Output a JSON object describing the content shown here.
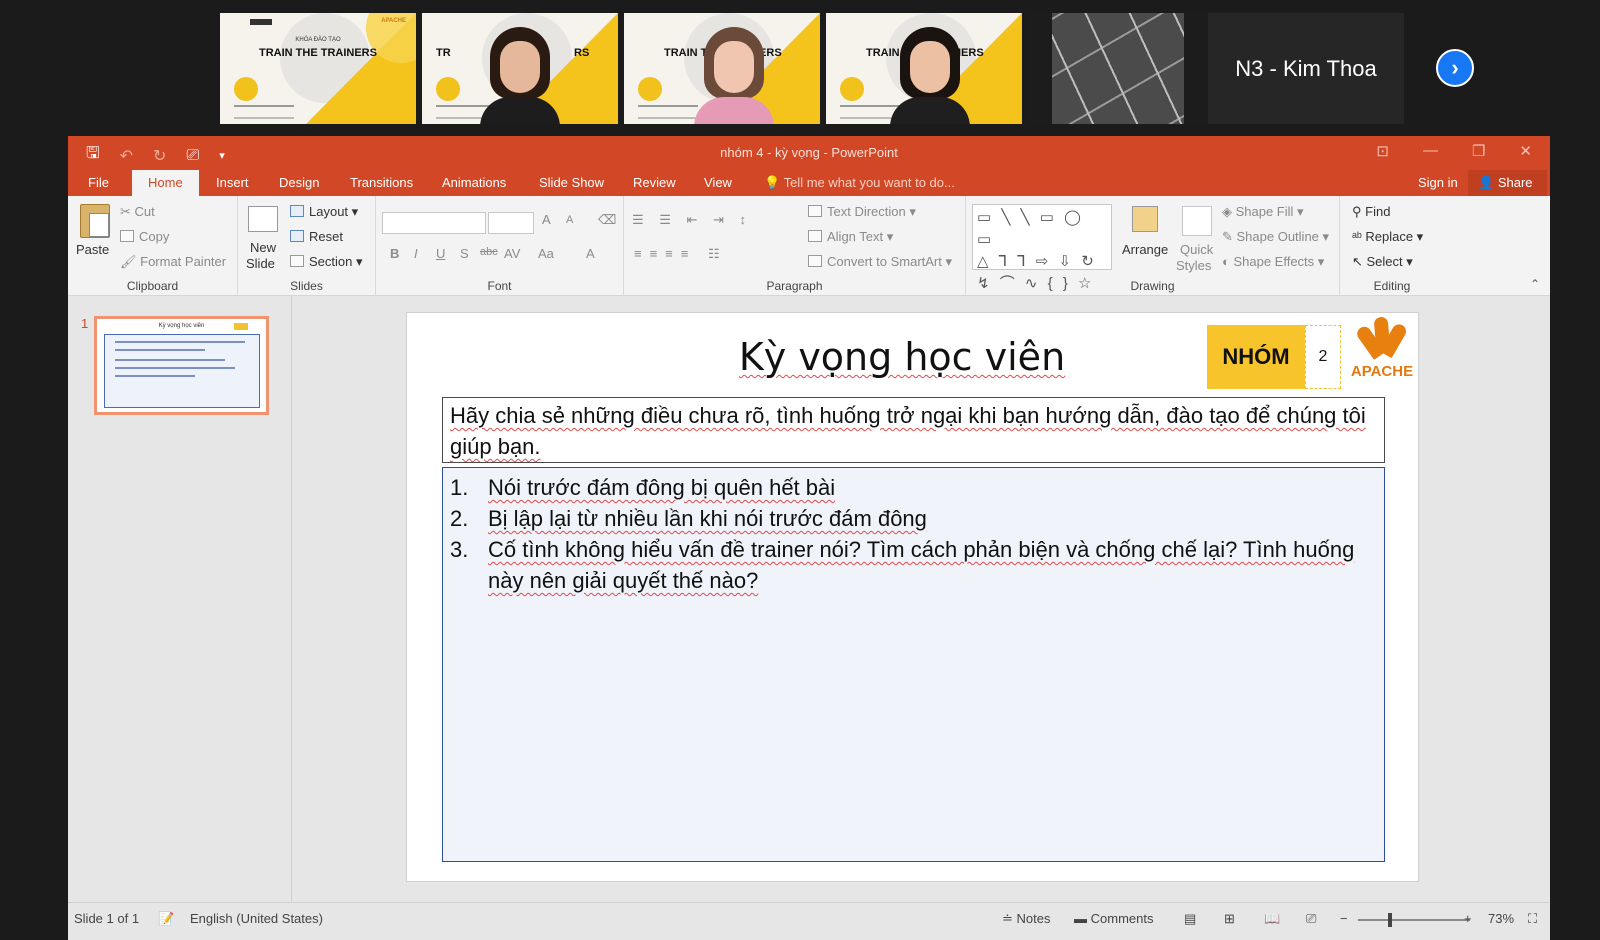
{
  "meeting": {
    "name_tile": "N3 - Kim Thoa",
    "slide_tile_sub": "KHÓA ĐÀO TẠO",
    "slide_tile_title": "TRAIN THE TRAINERS",
    "slide_tile_title_partial_1": "TR",
    "slide_tile_title_partial_1b": "RS",
    "slide_tile_title_partial_2": "TRAIN THE",
    "slide_tile_title_partial_2b": "IERS",
    "slide_tile_title_partial_3": "TRAIN",
    "slide_tile_title_partial_3b": "IERS",
    "tile_logo": "APACHE",
    "next_label": "›"
  },
  "window": {
    "title": "nhóm 4 - kỳ vọng - PowerPoint",
    "qat": {
      "save": "🖫",
      "undo": "↶",
      "redo": "↻",
      "present": "⎚",
      "more": "▾"
    },
    "controls": {
      "ribbon_display": "⊡",
      "minimize": "—",
      "restore": "❐",
      "close": "✕"
    }
  },
  "tabs": [
    "File",
    "Home",
    "Insert",
    "Design",
    "Transitions",
    "Animations",
    "Slide Show",
    "Review",
    "View"
  ],
  "active_tab": "Home",
  "tell_me": "Tell me what you want to do...",
  "sign_in": "Sign in",
  "share": "Share",
  "ribbon": {
    "clipboard": {
      "label": "Clipboard",
      "paste": "Paste",
      "cut": "Cut",
      "copy": "Copy",
      "format_painter": "Format Painter"
    },
    "slides": {
      "label": "Slides",
      "new_slide": "New",
      "new_slide_2": "Slide",
      "layout": "Layout",
      "reset": "Reset",
      "section": "Section"
    },
    "font": {
      "label": "Font",
      "font_name": "",
      "font_size": "",
      "grow": "A",
      "shrink": "A",
      "bold": "B",
      "italic": "I",
      "underline": "U",
      "strike": "S",
      "strike2": "abc",
      "spacing": "AV",
      "case": "Aa",
      "color": "A"
    },
    "paragraph": {
      "label": "Paragraph",
      "text_direction": "Text Direction",
      "align_text": "Align Text",
      "convert_smartart": "Convert to SmartArt"
    },
    "drawing": {
      "label": "Drawing",
      "arrange": "Arrange",
      "quick_styles": "Quick",
      "quick_styles_2": "Styles",
      "shape_fill": "Shape Fill",
      "shape_outline": "Shape Outline",
      "shape_effects": "Shape Effects",
      "shapes_row1": "▭ ╲ ╲ ▭ ◯ ▭",
      "shapes_row2": "△ ⅂ ⅂ ⇨ ⇩ ↻",
      "shapes_row3": "↯ ⌒ ∿ { } ☆"
    },
    "editing": {
      "label": "Editing",
      "find": "Find",
      "replace": "Replace",
      "select": "Select"
    }
  },
  "thumbnail": {
    "number": "1",
    "title": "Kỳ vọng học viên",
    "badge": "NHÓM"
  },
  "slide": {
    "title": "Kỳ vọng học viên",
    "badge": "NHÓM",
    "badge_number": "2",
    "logo": "APACHE",
    "prompt": "Hãy chia sẻ những điều chưa rõ, tình huống trở ngại khi bạn hướng dẫn, đào tạo để chúng tôi giúp bạn.",
    "items": [
      {
        "n": "1.",
        "text": "Nói trước đám đông bị quên hết bài"
      },
      {
        "n": "2.",
        "text": "Bị lập lại từ nhiều lần khi nói trước đám đông"
      },
      {
        "n": "3.",
        "text": "Cố tình không hiểu vấn đề trainer nói? Tìm cách phản biện và chống chế lại? Tình huống này nên giải quyết thế nào?"
      }
    ]
  },
  "status": {
    "slide_of": "Slide 1 of 1",
    "language": "English (United States)",
    "notes": "Notes",
    "comments": "Comments",
    "zoom_minus": "−",
    "zoom_plus": "+",
    "zoom": "73%"
  },
  "colors": {
    "accent": "#d24726",
    "badge": "#f8c42c",
    "logo": "#e07a10",
    "zoom_blue": "#1877f2"
  }
}
